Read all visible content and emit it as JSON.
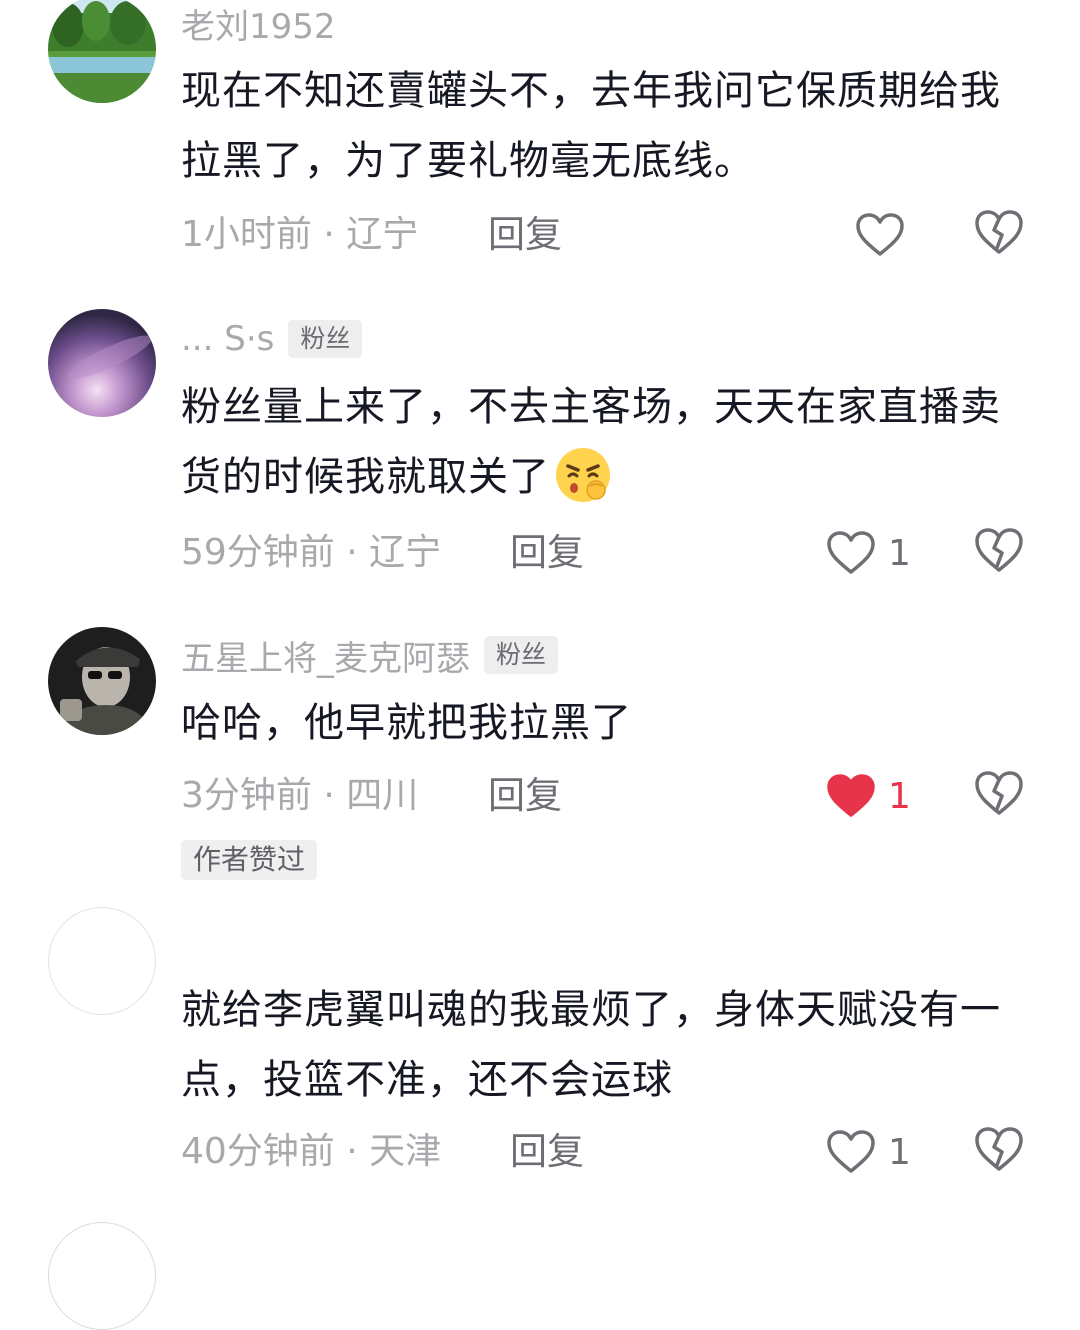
{
  "comments": [
    {
      "username": "老刘1952",
      "text": "现在不知还賣罐头不，去年我问它保质期给我拉黑了，为了要礼物毫无底线。",
      "time_location": "1小时前 · 辽宁",
      "reply_label": "回复",
      "like_count": "",
      "liked": false
    },
    {
      "username": "... S·s",
      "badge": "粉丝",
      "text": "粉丝量上来了，不去主客场，天天在家直播卖货的时候我就取关了",
      "time_location": "59分钟前 · 辽宁",
      "reply_label": "回复",
      "like_count": "1",
      "liked": false
    },
    {
      "username": "五星上将_麦克阿瑟",
      "badge": "粉丝",
      "text": "哈哈，他早就把我拉黑了",
      "time_location": "3分钟前 · 四川",
      "reply_label": "回复",
      "like_count": "1",
      "liked": true,
      "author_tag": "作者赞过"
    },
    {
      "username": "",
      "text": "就给李虎翼叫魂的我最烦了，身体天赋没有一点，投篮不准，还不会运球",
      "time_location": "40分钟前 · 天津",
      "reply_label": "回复",
      "like_count": "1",
      "liked": false
    }
  ],
  "colors": {
    "like_red": "#e8344a",
    "meta_gray": "#a8a9ad",
    "text_dark": "#161823"
  },
  "icons": {
    "like": "heart-outline-icon",
    "liked": "heart-filled-icon",
    "dislike": "broken-heart-icon",
    "emoji": "shushing-face-emoji"
  }
}
